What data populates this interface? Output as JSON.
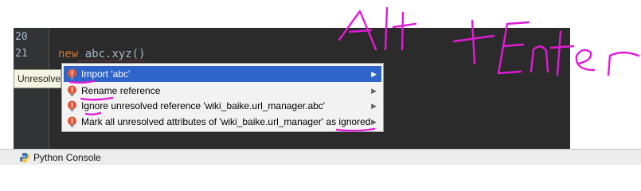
{
  "editor": {
    "lines": [
      {
        "number": "20",
        "code": ""
      },
      {
        "number": "21",
        "keyword": "new",
        "code": " abc.xyz()"
      }
    ]
  },
  "tooltip": {
    "text": "Unresolved reference 'abc'"
  },
  "intention_menu": {
    "items": [
      {
        "label": "Import 'abc'",
        "selected": true,
        "icon": "error-bulb-icon",
        "has_submenu": true
      },
      {
        "label": "Rename reference",
        "selected": false,
        "icon": "error-bulb-icon",
        "has_submenu": true
      },
      {
        "label": "Ignore unresolved reference 'wiki_baike.url_manager.abc'",
        "selected": false,
        "icon": "error-bulb-icon",
        "has_submenu": true
      },
      {
        "label": "Mark all unresolved attributes of 'wiki_baike.url_manager' as ignored",
        "selected": false,
        "icon": "error-bulb-icon",
        "has_submenu": true
      }
    ],
    "selected_color": "#2f65ca"
  },
  "statusbar": {
    "console_tab": "Python Console",
    "icon": "python-icon"
  },
  "annotation": {
    "text": "Alt + Enter",
    "color": "#e21ad6"
  }
}
